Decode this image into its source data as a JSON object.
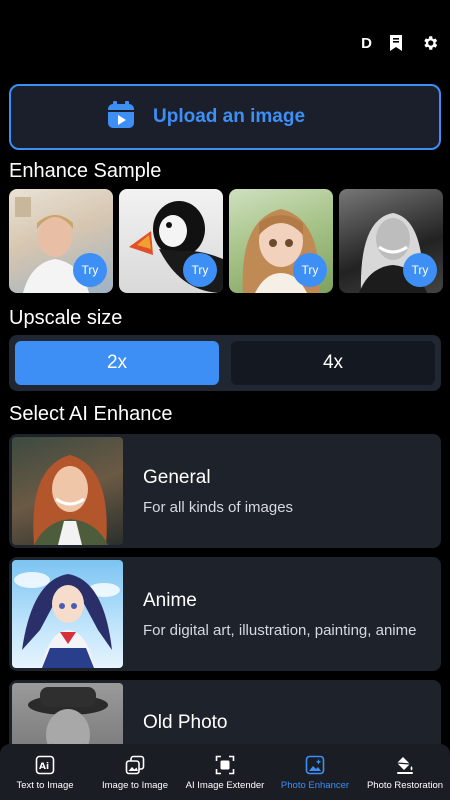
{
  "topbar": {
    "profile_initial": "D"
  },
  "upload": {
    "label": "Upload an image"
  },
  "enhance_sample": {
    "title": "Enhance Sample",
    "items": [
      {
        "try_label": "Try"
      },
      {
        "try_label": "Try"
      },
      {
        "try_label": "Try"
      },
      {
        "try_label": "Try"
      }
    ]
  },
  "upscale": {
    "title": "Upscale size",
    "options": [
      "2x",
      "4x"
    ],
    "selected": "2x"
  },
  "ai_enhance": {
    "title": "Select AI Enhance",
    "cards": [
      {
        "title": "General",
        "subtitle": "For all kinds of images"
      },
      {
        "title": "Anime",
        "subtitle": "For digital art, illustration, painting, anime"
      },
      {
        "title": "Old Photo",
        "subtitle": ""
      }
    ]
  },
  "bottom_nav": {
    "items": [
      {
        "label": "Text to Image",
        "icon": "ai-text-icon"
      },
      {
        "label": "Image to Image",
        "icon": "image-swap-icon"
      },
      {
        "label": "AI Image Extender",
        "icon": "expand-frame-icon"
      },
      {
        "label": "Photo Enhancer",
        "icon": "sparkle-image-icon"
      },
      {
        "label": "Photo Restoration",
        "icon": "paint-bucket-icon"
      }
    ],
    "active": "Photo Enhancer"
  },
  "colors": {
    "accent": "#3d8ff5",
    "card_bg": "#1d222b",
    "background": "#000000"
  }
}
